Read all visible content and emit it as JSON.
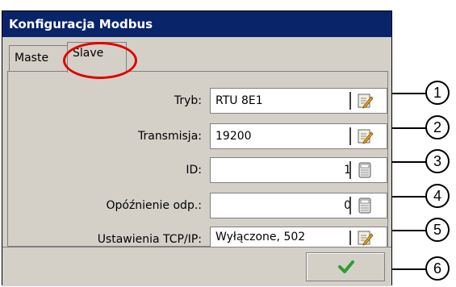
{
  "window": {
    "title": "Konfiguracja Modbus"
  },
  "tabs": [
    {
      "label": "Maste"
    },
    {
      "label": "Slave"
    }
  ],
  "fields": [
    {
      "label": "Tryb:",
      "value": "RTU 8E1",
      "icon": "edit-icon"
    },
    {
      "label": "Transmisja:",
      "value": "19200",
      "icon": "edit-icon"
    },
    {
      "label": "ID:",
      "value": "1",
      "icon": "calculator-icon"
    },
    {
      "label": "Opóźnienie odp.:",
      "value": "0",
      "icon": "calculator-icon"
    },
    {
      "label": "Ustawienia TCP/IP:",
      "value": "Wyłączone, 502",
      "icon": "edit-icon"
    }
  ],
  "ok_button": {
    "icon": "checkmark-icon"
  },
  "callouts": [
    "1",
    "2",
    "3",
    "4",
    "5",
    "6"
  ],
  "colors": {
    "titlebar": "#0a246a",
    "highlight": "#e00000",
    "check": "#2e9e2e"
  }
}
